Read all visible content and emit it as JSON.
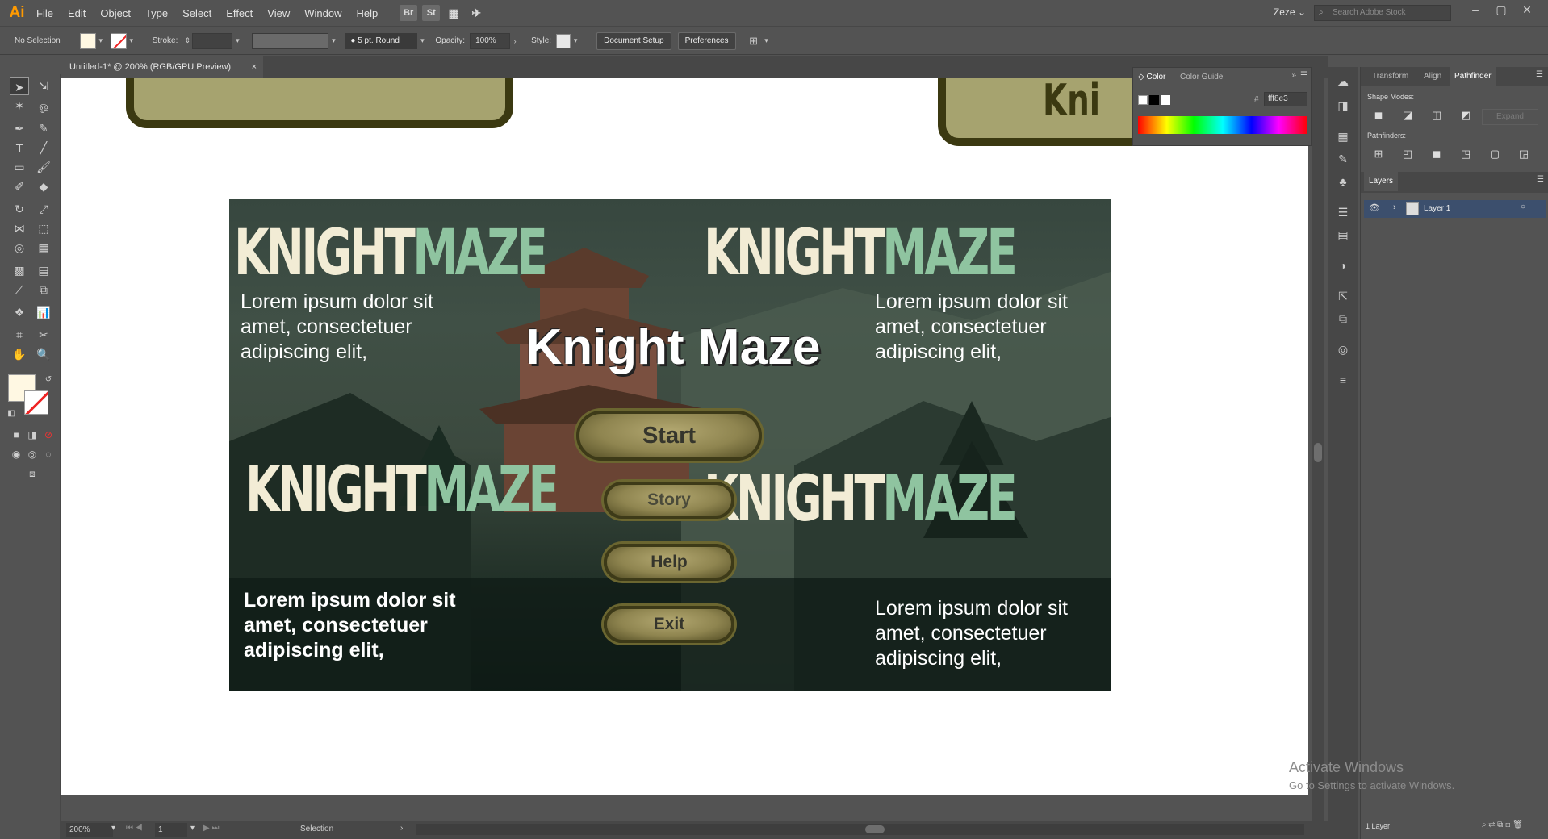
{
  "menubar": {
    "logo": "Ai",
    "items": [
      "File",
      "Edit",
      "Object",
      "Type",
      "Select",
      "Effect",
      "View",
      "Window",
      "Help"
    ],
    "icons": [
      "Br",
      "St"
    ],
    "workspace": "Zeze",
    "stock_placeholder": "Search Adobe Stock"
  },
  "control": {
    "selection": "No Selection",
    "stroke_label": "Stroke:",
    "brush": "5 pt. Round",
    "opacity_label": "Opacity:",
    "opacity": "100%",
    "style_label": "Style:",
    "doc_setup": "Document Setup",
    "preferences": "Preferences"
  },
  "doc": {
    "tab": "Untitled-1* @ 200% (RGB/GPU Preview)",
    "close": "×"
  },
  "artwork": {
    "logo_k": "KNIGHT",
    "logo_m": "MAZE",
    "lorem": "Lorem ipsum dolor sit amet, consectetuer adipiscing elit,",
    "lorem_l1": "Lorem ipsum dolor sit",
    "lorem_l2": "amet, consectetuer",
    "lorem_l3": "adipiscing elit,",
    "title": "Knight Maze",
    "buttons": [
      "Start",
      "Story",
      "Help",
      "Exit"
    ],
    "partial_logo": "Kni"
  },
  "color_panel": {
    "tab1": "Color",
    "tab2": "Color Guide",
    "hex": "fff8e3"
  },
  "right_panel": {
    "tabs": [
      "Transform",
      "Align",
      "Pathfinder"
    ],
    "shape_modes": "Shape Modes:",
    "expand": "Expand",
    "pathfinders": "Pathfinders:",
    "layers_tab": "Layers",
    "layer_name": "Layer 1",
    "layer_count": "1 Layer"
  },
  "status": {
    "zoom": "200%",
    "page": "1",
    "tool": "Selection"
  },
  "watermark": {
    "line1": "Activate Windows",
    "line2": "Go to Settings to activate Windows."
  },
  "colors": {
    "fill": "#fff8e3",
    "accent": "#ff9a00",
    "logo_light": "#f2ecd5",
    "logo_green": "#8fc4a0"
  }
}
